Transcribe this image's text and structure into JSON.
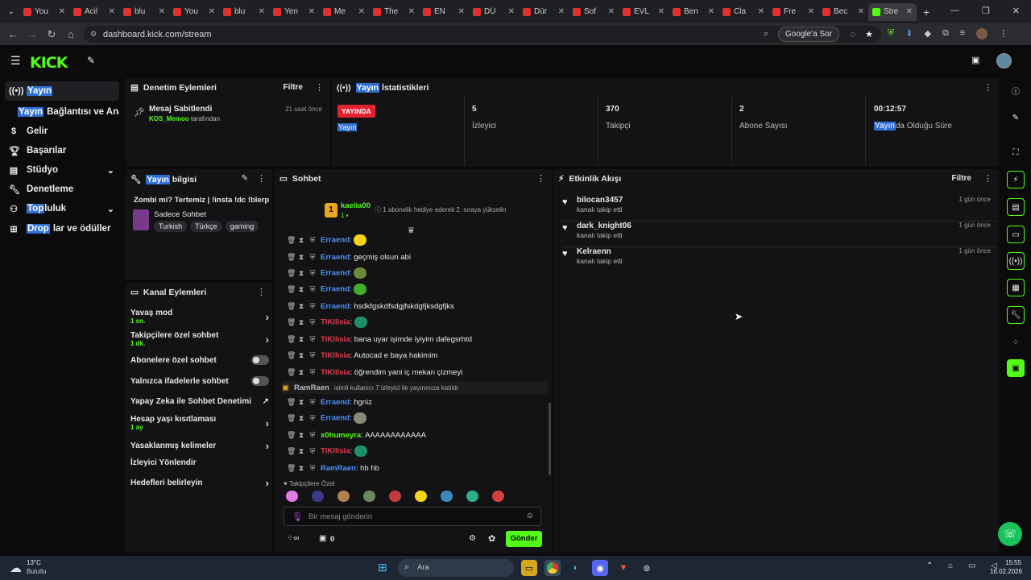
{
  "browser": {
    "tabs": [
      "You",
      "Acil",
      "blu",
      "You",
      "blu",
      "Yen",
      "Me",
      "The",
      "EN",
      "DÜ",
      "Dür",
      "Sof",
      "EVL",
      "Ben",
      "Cla",
      "Fre",
      "Bec",
      "Stre"
    ],
    "url": "dashboard.kick.com/stream",
    "google_button": "Google'a Sor",
    "nav_icons": [
      "back-icon",
      "forward-icon",
      "reload-icon",
      "home-icon"
    ]
  },
  "sidebar": {
    "items": [
      {
        "label": "Yayın",
        "icon": "broadcast-icon"
      },
      {
        "label_hl": "Yayın",
        "label": "Bağlantısı ve Anahtar"
      },
      {
        "label": "Gelir",
        "icon": "dollar-icon"
      },
      {
        "label": "Başarılar",
        "icon": "trophy-icon"
      },
      {
        "label": "Stüdyo",
        "icon": "studio-icon"
      },
      {
        "label": "Denetleme",
        "icon": "wrench-icon"
      },
      {
        "label_hl": "Top",
        "label": "luluk",
        "icon": "community-icon"
      },
      {
        "label_hl": "Drop",
        "label": "lar ve ödüller",
        "icon": "gift-icon"
      }
    ]
  },
  "mod_actions": {
    "title": "Denetim Eylemleri",
    "filter": "Filtre",
    "item_title": "Mesaj Sabitlendi",
    "item_user": "KOS_Memoo",
    "item_suffix": "tarafından",
    "item_time": "21 saat önce"
  },
  "stats": {
    "title_hl": "Yayın",
    "title": "İstatistikleri",
    "live_badge": "YAYINDA",
    "live_sub": "Yayın",
    "items": [
      {
        "value": "5",
        "label": "İzleyici"
      },
      {
        "value": "370",
        "label": "Takipçi"
      },
      {
        "value": "2",
        "label": "Abone Sayısı"
      },
      {
        "value": "00:12:57",
        "label_hl": "Yayın",
        "label": "da Olduğu Süre"
      }
    ]
  },
  "stream_info": {
    "title_hl": "Yayın",
    "title": "bilgisi",
    "stream_title": "Zombi mi? Tertemiz | !insta !dc !blerp",
    "category": "Sadece Sohbet",
    "tags": [
      "Turkish",
      "Türkçe",
      "gaming"
    ]
  },
  "channel_actions": {
    "title": "Kanal Eylemleri",
    "rows": [
      {
        "label": "Yavaş mod",
        "sub": "1 sn.",
        "control": "chevron"
      },
      {
        "label": "Takipçilere özel sohbet",
        "sub": "1 dk.",
        "control": "chevron"
      },
      {
        "label": "Abonelere özel sohbet",
        "sub": "",
        "control": "toggle"
      },
      {
        "label": "Yalnızca ifadelerle sohbet",
        "sub": "",
        "control": "toggle"
      },
      {
        "label": "Yapay Zeka ile Sohbet Denetimi",
        "sub": "",
        "control": "external"
      },
      {
        "label": "Hesap yaşı kısıtlaması",
        "sub": "1 ay",
        "control": "chevron"
      },
      {
        "label": "Yasaklanmış kelimeler",
        "sub": "",
        "control": "chevron"
      },
      {
        "label": "İzleyici Yönlendir",
        "sub": "",
        "control": "none"
      },
      {
        "label": "Hedefleri belirleyin",
        "sub": "",
        "control": "chevron"
      }
    ]
  },
  "chat": {
    "title": "Sohbet",
    "pinned_user": "kaelia00",
    "pinned_level": "1",
    "pinned_sub": "1",
    "pinned_note": "1 abonelik hediye ederek 2. sıraya yükselin",
    "messages": [
      {
        "user": "Erraend",
        "text": "",
        "emote": "#f2d51b",
        "cls": "u1"
      },
      {
        "user": "Erraend",
        "text": "geçmiş olsun abi",
        "emote": "",
        "cls": "u1"
      },
      {
        "user": "Erraend",
        "text": "",
        "emote": "#6a8a3a",
        "cls": "u1"
      },
      {
        "user": "Erraend",
        "text": "",
        "emote": "#3fae2a",
        "cls": "u1"
      },
      {
        "user": "Erraend",
        "text": "hsdkfgskdfsdgjfskdgfjksdgfjks",
        "emote": "",
        "cls": "u1"
      },
      {
        "user": "TIKIlisia",
        "text": "",
        "emote": "#1f8f6a",
        "cls": "u2"
      },
      {
        "user": "TIKIlisia",
        "text": "bana uyar işimde iyiyim dafegsrhtd",
        "emote": "",
        "cls": "u2"
      },
      {
        "user": "TIKIlisia",
        "text": "Autocad e baya hakimim",
        "emote": "",
        "cls": "u2"
      },
      {
        "user": "TIKIlisia",
        "text": "öğrendim yani iç mekan çizmeyi",
        "emote": "",
        "cls": "u2"
      },
      {
        "system": true,
        "user": "RamRaen",
        "text": "isimli kullanıcı 7 izleyici ile yayınınıza katıldı"
      },
      {
        "user": "Erraend",
        "text": "hgniz",
        "emote": "",
        "cls": "u1"
      },
      {
        "user": "Erraend",
        "text": "",
        "emote": "#8a8a7a",
        "cls": "u1"
      },
      {
        "user": "x0humeyra",
        "text": "AAAAAAAAAAAA",
        "emote": "",
        "cls": "u3"
      },
      {
        "user": "TIKIlisia",
        "text": "",
        "emote": "#1f8f6a",
        "cls": "u2"
      },
      {
        "user": "RamRaen",
        "text": "hb hb",
        "emote": "",
        "cls": "u1"
      }
    ],
    "emote_section": "Takipçilere Özel",
    "input_placeholder": "Bir mesaj gönderin",
    "points": "0",
    "send": "Gönder"
  },
  "activity": {
    "title": "Etkinlik Akışı",
    "filter": "Filtre",
    "items": [
      {
        "name": "bilocan3457",
        "sub": "kanalı takip etti",
        "time": "1 gün önce"
      },
      {
        "name": "dark_knight06",
        "sub": "kanalı takip etti",
        "time": "1 gün önce"
      },
      {
        "name": "Kelraenn",
        "sub": "kanalı takip etti",
        "time": "1 gün önce"
      }
    ]
  },
  "taskbar": {
    "weather_temp": "13°C",
    "weather_desc": "Bulutlu",
    "search": "Ara",
    "time": "15:55",
    "date": "16.02.2026"
  },
  "colors": {
    "accent": "#53fc18",
    "live": "#e0232f",
    "highlight": "#2e6fd6"
  }
}
